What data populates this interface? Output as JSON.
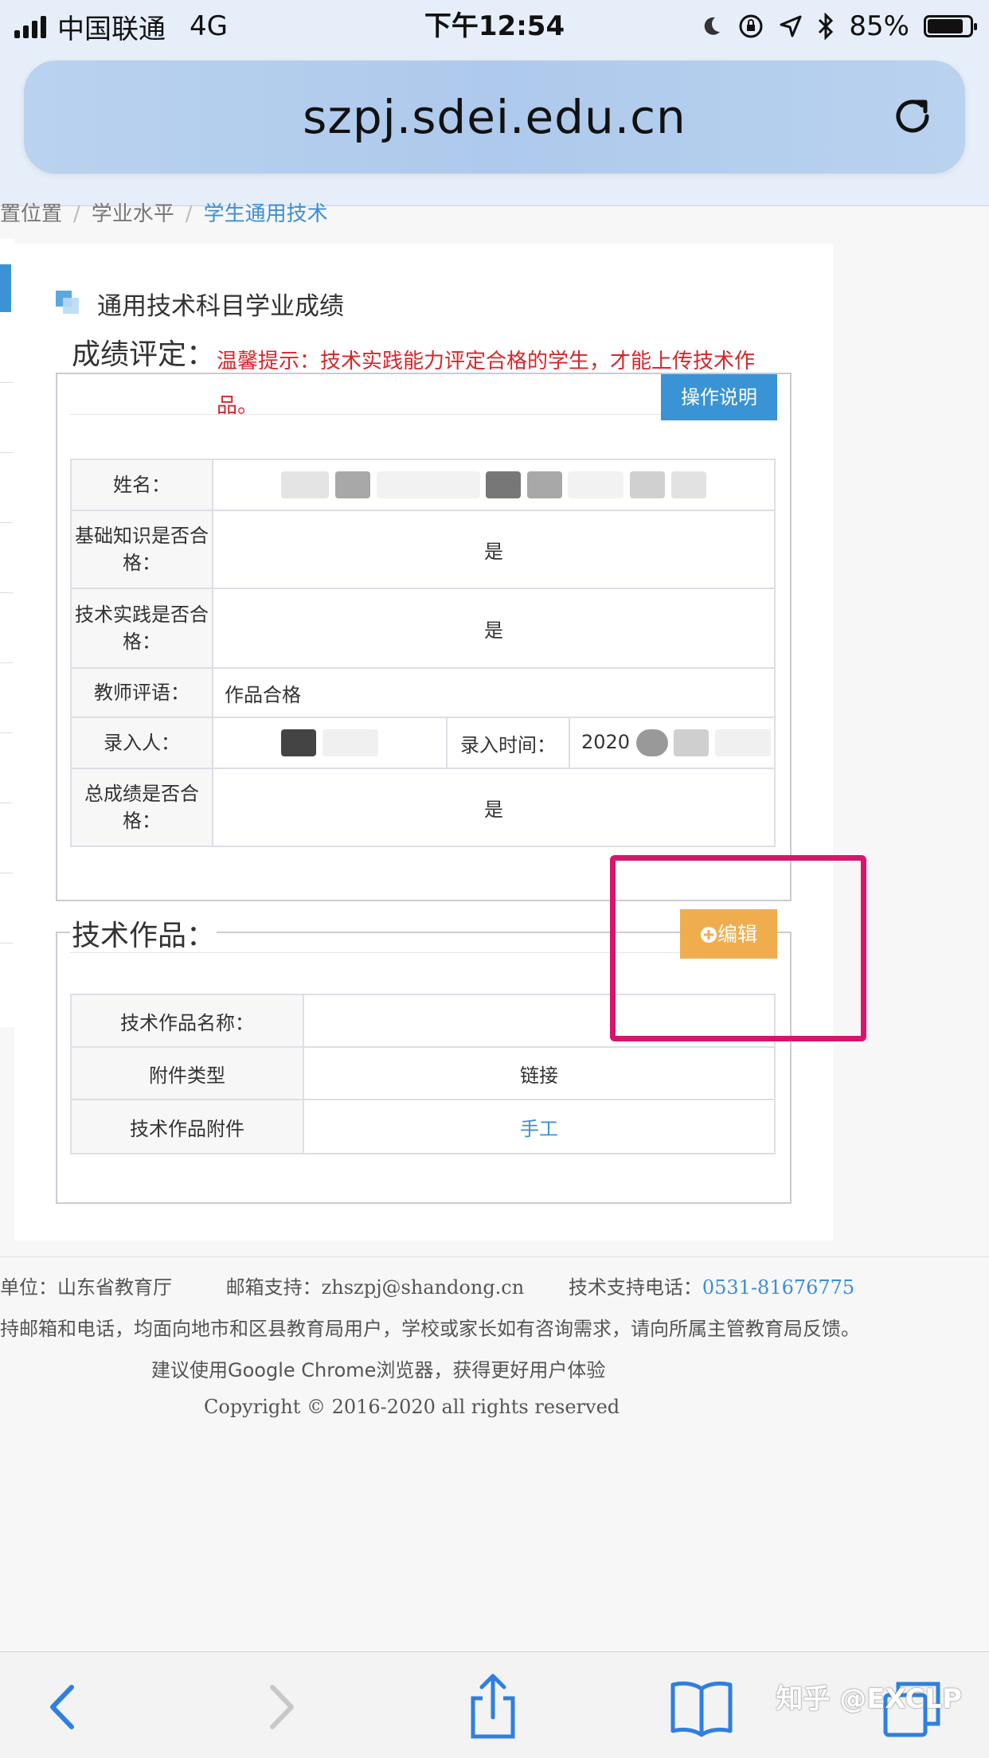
{
  "status_bar": {
    "carrier": "中国联通",
    "network": "4G",
    "time": "下午12:54",
    "battery": "85%",
    "battery_level": 0.85
  },
  "browser": {
    "url": "szpj.sdei.edu.cn"
  },
  "breadcrumb": [
    "置位置",
    "学业水平",
    "学生通用技术"
  ],
  "section": {
    "title": "通用技术科目学业成绩"
  },
  "grade": {
    "legend": "成绩评定：",
    "tip": "温馨提示：技术实践能力评定合格的学生，才能上传技术作品。",
    "help_button": "操作说明",
    "rows": {
      "name_label": "姓名：",
      "basic_label": "基础知识是否合格：",
      "basic_value": "是",
      "practice_label": "技术实践是否合格：",
      "practice_value": "是",
      "comment_label": "教师评语：",
      "comment_value": "作品合格",
      "entry_person_label": "录入人：",
      "entry_time_label": "录入时间：",
      "entry_time_value": "2020",
      "total_label": "总成绩是否合格：",
      "total_value": "是"
    }
  },
  "works": {
    "legend": "技术作品：",
    "edit_button": "编辑",
    "rows": [
      {
        "label": "技术作品名称：",
        "value": ""
      },
      {
        "label": "附件类型",
        "value": "链接"
      },
      {
        "label": "技术作品附件",
        "value": "手工"
      }
    ]
  },
  "footer": {
    "org": "单位：山东省教育厅",
    "email_label": "邮箱支持：",
    "email": "zhszpj@shandong.cn",
    "phone_label": "技术支持电话：",
    "phone": "0531-81676775",
    "notice": "持邮箱和电话，均面向地市和区县教育局用户，学校或家长如有咨询需求，请向所属主管教育局反馈。",
    "browser_tip": "建议使用Google Chrome浏览器，获得更好用户体验",
    "copyright": "Copyright © 2016-2020 all rights reserved"
  },
  "watermark": "知乎 @EXCLP",
  "colors": {
    "primary": "#3a93d5",
    "warning": "#f0ad4e",
    "tip_red": "#d7262b",
    "highlight": "#d6166c"
  }
}
